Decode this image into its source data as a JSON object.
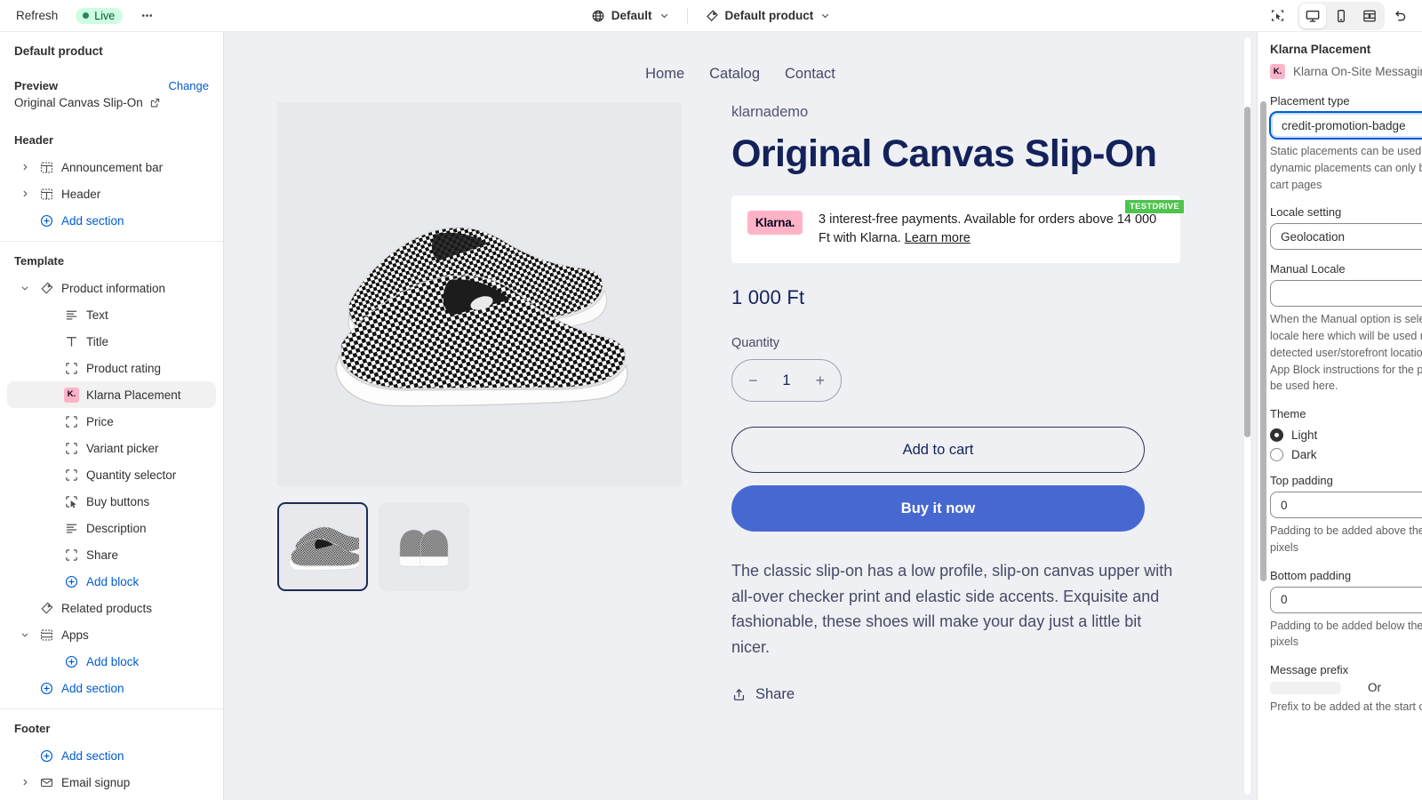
{
  "topbar": {
    "refresh_label": "Refresh",
    "live_label": "Live",
    "more_label": "•••",
    "theme_selector": "Default",
    "template_selector": "Default product",
    "icons": {
      "globe": "globe-icon",
      "tag": "tag-icon",
      "inspector": "inspector-icon",
      "desktop": "desktop-icon",
      "mobile": "mobile-icon",
      "fullscreen": "fullscreen-icon",
      "undo": "undo-icon"
    }
  },
  "sidebar": {
    "title": "Default product",
    "preview_label": "Preview",
    "change_label": "Change",
    "preview_value": "Original Canvas Slip-On",
    "groups": [
      {
        "name": "Header",
        "items": [
          {
            "label": "Announcement bar",
            "icon": "section-icon",
            "caret": true,
            "indent": 1,
            "kind": "item"
          },
          {
            "label": "Header",
            "icon": "section-icon",
            "caret": true,
            "indent": 1,
            "kind": "item"
          },
          {
            "label": "Add section",
            "icon": "plus-circle-icon",
            "caret": false,
            "indent": 1,
            "kind": "add"
          }
        ]
      },
      {
        "name": "Template",
        "items": [
          {
            "label": "Product information",
            "icon": "tag-icon",
            "caret": true,
            "expanded": true,
            "indent": 1,
            "kind": "item"
          },
          {
            "label": "Text",
            "icon": "text-icon",
            "caret": false,
            "indent": 2,
            "kind": "item"
          },
          {
            "label": "Title",
            "icon": "title-icon",
            "caret": false,
            "indent": 2,
            "kind": "item"
          },
          {
            "label": "Product rating",
            "icon": "block-icon",
            "caret": false,
            "indent": 2,
            "kind": "item"
          },
          {
            "label": "Klarna Placement",
            "icon": "klarna-icon",
            "caret": false,
            "indent": 2,
            "kind": "item",
            "selected": true
          },
          {
            "label": "Price",
            "icon": "block-icon",
            "caret": false,
            "indent": 2,
            "kind": "item"
          },
          {
            "label": "Variant picker",
            "icon": "block-icon",
            "caret": false,
            "indent": 2,
            "kind": "item"
          },
          {
            "label": "Quantity selector",
            "icon": "block-icon",
            "caret": false,
            "indent": 2,
            "kind": "item"
          },
          {
            "label": "Buy buttons",
            "icon": "cursor-block-icon",
            "caret": false,
            "indent": 2,
            "kind": "item"
          },
          {
            "label": "Description",
            "icon": "text-icon",
            "caret": false,
            "indent": 2,
            "kind": "item"
          },
          {
            "label": "Share",
            "icon": "block-icon",
            "caret": false,
            "indent": 2,
            "kind": "item"
          },
          {
            "label": "Add block",
            "icon": "plus-circle-icon",
            "caret": false,
            "indent": 2,
            "kind": "add"
          },
          {
            "label": "Related products",
            "icon": "tag-icon",
            "caret": false,
            "indent": 1,
            "kind": "item"
          },
          {
            "label": "Apps",
            "icon": "apps-icon",
            "caret": true,
            "expanded": true,
            "indent": 1,
            "kind": "item"
          },
          {
            "label": "Add block",
            "icon": "plus-circle-icon",
            "caret": false,
            "indent": 2,
            "kind": "add"
          },
          {
            "label": "Add section",
            "icon": "plus-circle-icon",
            "caret": false,
            "indent": 1,
            "kind": "add"
          }
        ]
      },
      {
        "name": "Footer",
        "items": [
          {
            "label": "Add section",
            "icon": "plus-circle-icon",
            "caret": false,
            "indent": 1,
            "kind": "add"
          },
          {
            "label": "Email signup",
            "icon": "email-icon",
            "caret": true,
            "indent": 1,
            "kind": "item"
          }
        ]
      }
    ]
  },
  "preview": {
    "nav": [
      "Home",
      "Catalog",
      "Contact"
    ],
    "vendor": "klarnademo",
    "title": "Original Canvas Slip-On",
    "klarna": {
      "logo_text": "Klarna.",
      "message": "3 interest-free payments. Available for orders above 14 000 Ft with Klarna. ",
      "link_text": "Learn more",
      "badge": "TESTDRIVE"
    },
    "price": "1 000 Ft",
    "quantity_label": "Quantity",
    "quantity_value": "1",
    "decrement": "−",
    "increment": "+",
    "add_to_cart": "Add to cart",
    "buy_it_now": "Buy it now",
    "description": "The classic slip-on has a low profile, slip-on canvas upper with all-over checker print and elastic side accents. Exquisite and fashionable, these shoes will make your day just a little bit nicer.",
    "share_label": "Share"
  },
  "right_panel": {
    "title": "Klarna Placement",
    "app_name": "Klarna On-Site Messaging",
    "placement_type_label": "Placement type",
    "placement_type_value": "credit-promotion-badge",
    "placement_type_help": "Static placements can be used on any pages, while dynamic placements can only be used on product and cart pages",
    "locale_setting_label": "Locale setting",
    "locale_setting_value": "Geolocation",
    "manual_locale_label": "Manual Locale",
    "manual_locale_value": "",
    "manual_locale_help": "When the Manual option is selected above, specify a locale here which will be used regardless of the detected user/storefront location. Please refer to the App Block instructions for the possible values that can be used here.",
    "theme_label": "Theme",
    "theme_options": [
      "Light",
      "Dark"
    ],
    "theme_selected": "Light",
    "top_padding_label": "Top padding",
    "top_padding_value": "0",
    "top_padding_help": "Padding to be added above the placement block in pixels",
    "bottom_padding_label": "Bottom padding",
    "bottom_padding_value": "0",
    "bottom_padding_help": "Padding to be added below the placement block in pixels",
    "message_prefix_label": "Message prefix",
    "message_prefix_or": "Or",
    "message_prefix_help": "Prefix to be added at the start of the placement's text"
  },
  "colors": {
    "accent_blue": "#005bd3",
    "klarna_pink": "#ffb3c7",
    "live_green_bg": "#cdfee1",
    "live_green_text": "#0c5132",
    "buy_blue": "#4868d1",
    "title_navy": "#14225b",
    "testdrive_green": "#4ec34e"
  }
}
